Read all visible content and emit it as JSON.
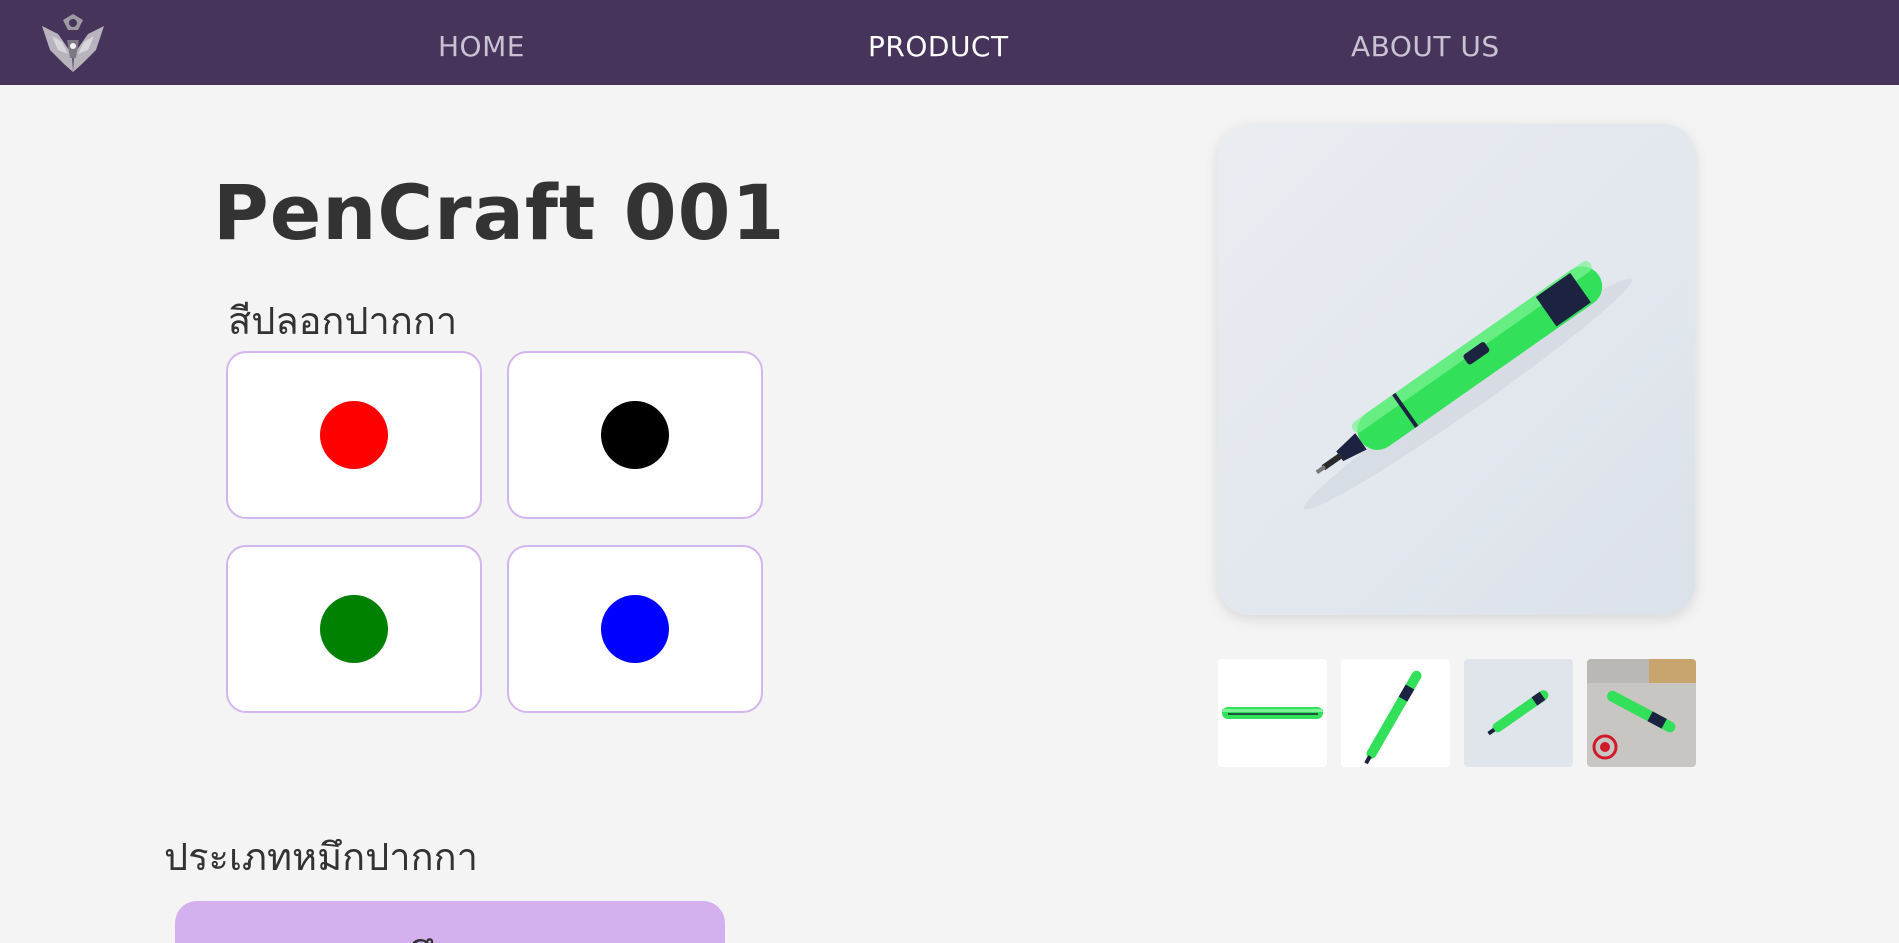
{
  "nav": {
    "logo": "shield-crest-logo",
    "items": [
      {
        "label": "HOME",
        "active": false
      },
      {
        "label": "PRODUCT",
        "active": true
      },
      {
        "label": "ABOUT US",
        "active": false
      }
    ]
  },
  "product": {
    "title": "PenCraft 001",
    "color_section_label": "สีปลอกปากกา",
    "colors": [
      {
        "name": "red",
        "hex": "#ff0000"
      },
      {
        "name": "black",
        "hex": "#000000"
      },
      {
        "name": "green",
        "hex": "#008000"
      },
      {
        "name": "blue",
        "hex": "#0000ff"
      }
    ],
    "ink_section_label": "ประเภทหมึกปากกา",
    "ink_option_label": "หมึกเจล"
  },
  "gallery": {
    "main_image": "green-pen-photo",
    "thumbnails": [
      "pen-side-view",
      "pen-diagonal-view",
      "pen-on-grey",
      "pen-with-stamp"
    ]
  },
  "theme": {
    "nav_bg": "#46345a",
    "accent": "#d4b0ef",
    "pen_green": "#33e05a"
  }
}
